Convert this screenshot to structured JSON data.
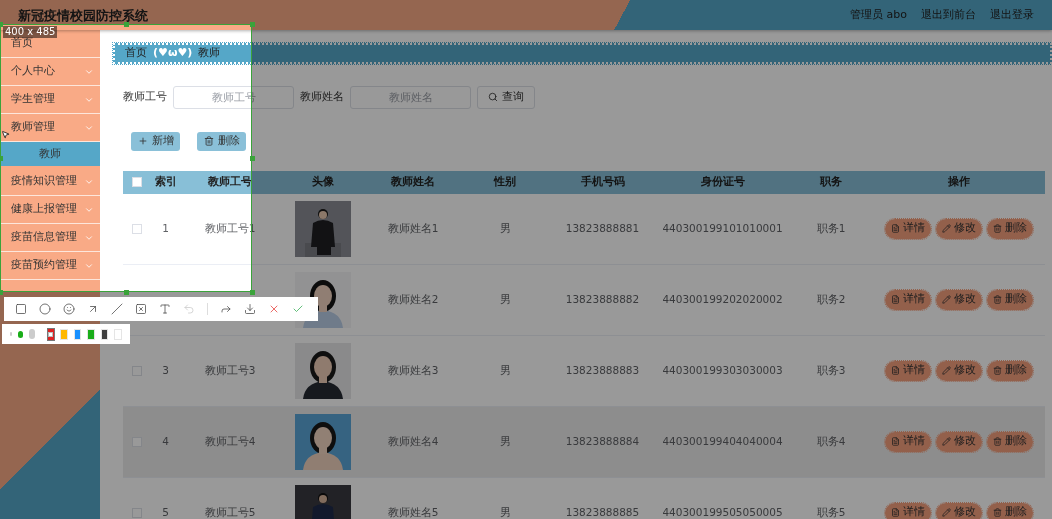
{
  "header": {
    "title": "新冠疫情校园防控系统",
    "user": "管理员 abo",
    "links": [
      "退出到前台",
      "退出登录"
    ]
  },
  "sidebar": {
    "items": [
      {
        "label": "首页",
        "kind": "link",
        "selected": false
      },
      {
        "label": "个人中心",
        "kind": "group",
        "selected": false
      },
      {
        "label": "学生管理",
        "kind": "group",
        "selected": false
      },
      {
        "label": "教师管理",
        "kind": "group",
        "selected": false
      },
      {
        "label": "教师",
        "kind": "sub",
        "selected": true
      },
      {
        "label": "疫情知识管理",
        "kind": "group",
        "selected": false
      },
      {
        "label": "健康上报管理",
        "kind": "group",
        "selected": false
      },
      {
        "label": "疫苗信息管理",
        "kind": "group",
        "selected": false
      },
      {
        "label": "疫苗预约管理",
        "kind": "group",
        "selected": false
      }
    ]
  },
  "breadcrumb": {
    "items": [
      "首页",
      "教师"
    ],
    "separator": "(♥ω♥)"
  },
  "search": {
    "fields": [
      {
        "label": "教师工号",
        "placeholder": "教师工号"
      },
      {
        "label": "教师姓名",
        "placeholder": "教师姓名"
      }
    ],
    "button": "查询"
  },
  "actions": [
    {
      "kind": "add",
      "label": "新增"
    },
    {
      "kind": "delete",
      "label": "删除"
    }
  ],
  "table": {
    "all_checked": false,
    "columns": {
      "index": "索引",
      "teacher_no": "教师工号",
      "avatar": "头像",
      "name": "教师姓名",
      "gender": "性别",
      "phone": "手机号码",
      "id_card": "身份证号",
      "position": "职务",
      "actions": "操作"
    },
    "rows": [
      {
        "checked": false,
        "hovered": false,
        "index": "1",
        "teacher_no": "教师工号1",
        "name": "教师姓名1",
        "gender": "男",
        "phone": "13823888881",
        "id_card": "440300199101010001",
        "position": "职务1",
        "actions": [
          "详情",
          "修改",
          "删除"
        ]
      },
      {
        "hovered": false,
        "name": "教师姓名2",
        "gender": "男",
        "phone": "13823888882",
        "id_card": "440300199202020002",
        "position": "职务2",
        "actions": [
          "详情",
          "修改",
          "删除"
        ]
      },
      {
        "checked": false,
        "hovered": false,
        "index": "3",
        "teacher_no": "教师工号3",
        "name": "教师姓名3",
        "gender": "男",
        "phone": "13823888883",
        "id_card": "440300199303030003",
        "position": "职务3",
        "actions": [
          "详情",
          "修改",
          "删除"
        ]
      },
      {
        "checked": false,
        "hovered": true,
        "index": "4",
        "teacher_no": "教师工号4",
        "name": "教师姓名4",
        "gender": "男",
        "phone": "13823888884",
        "id_card": "440300199404040004",
        "position": "职务4",
        "actions": [
          "详情",
          "修改",
          "删除"
        ]
      },
      {
        "checked": false,
        "hovered": false,
        "index": "5",
        "teacher_no": "教师工号5",
        "name": "教师姓名5",
        "gender": "男",
        "phone": "13823888885",
        "id_card": "440300199505050005",
        "position": "职务5",
        "actions": [
          "详情",
          "修改",
          "删除"
        ]
      }
    ]
  },
  "capture": {
    "size": "400 x 485",
    "tools": [
      {
        "kind": "rect",
        "disabled": false
      },
      {
        "kind": "ellipse",
        "disabled": false
      },
      {
        "kind": "emoji",
        "disabled": false
      },
      {
        "kind": "arrow",
        "disabled": false
      },
      {
        "kind": "line",
        "disabled": false
      },
      {
        "kind": "mosaic",
        "disabled": false
      },
      {
        "kind": "text",
        "disabled": false
      },
      {
        "kind": "undo",
        "disabled": true
      },
      {
        "kind": "redo",
        "disabled": false
      },
      {
        "kind": "save",
        "disabled": false
      },
      {
        "kind": "cancel",
        "disabled": false
      },
      {
        "kind": "confirm",
        "disabled": false
      }
    ],
    "pen_sizes": [
      {
        "kind": "small",
        "selected": false
      },
      {
        "kind": "medium",
        "selected": true
      },
      {
        "kind": "large",
        "selected": false
      }
    ],
    "colors": [
      {
        "color": "#e02020",
        "selected": true
      },
      {
        "color": "#ffb800",
        "selected": false
      },
      {
        "color": "#1890ff",
        "selected": false
      },
      {
        "color": "#1aad19",
        "selected": false
      },
      {
        "color": "#3f3f3f",
        "selected": false
      },
      {
        "color": "#ffffff",
        "selected": false
      }
    ]
  }
}
